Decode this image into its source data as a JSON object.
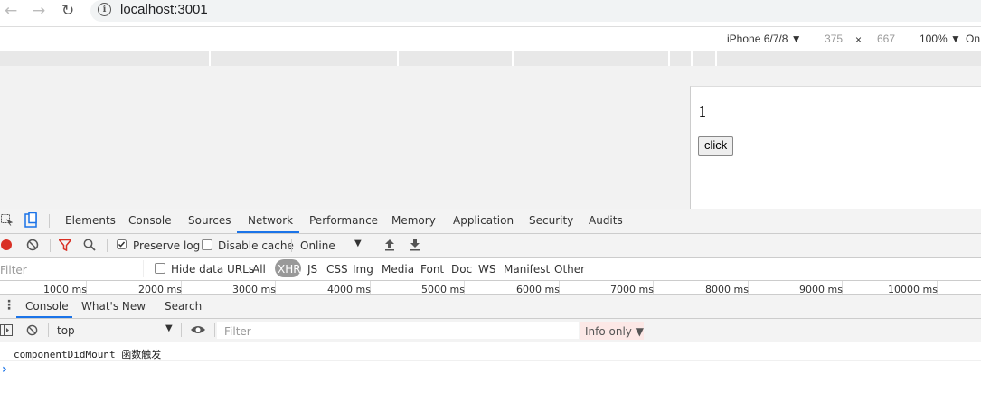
{
  "browser": {
    "url": "localhost:3001",
    "back_icon": "arrow-left-icon",
    "forward_icon": "arrow-right-icon",
    "reload_icon": "reload-icon",
    "info_icon": "info-icon"
  },
  "device_toolbar": {
    "device": "iPhone 6/7/8 ▼",
    "width": "375",
    "times": "×",
    "height": "667",
    "zoom": "100% ▼",
    "throttle": "On"
  },
  "page": {
    "counter": "1",
    "button_label": "click"
  },
  "devtools": {
    "tabs": [
      "Elements",
      "Console",
      "Sources",
      "Network",
      "Performance",
      "Memory",
      "Application",
      "Security",
      "Audits"
    ],
    "active_tab": "Network",
    "network_toolbar": {
      "preserve_log": "Preserve log",
      "disable_cache": "Disable cache",
      "throttling": "Online"
    },
    "filter": {
      "placeholder": "Filter",
      "hide_data_urls": "Hide data URLs",
      "types": [
        "All",
        "XHR",
        "JS",
        "CSS",
        "Img",
        "Media",
        "Font",
        "Doc",
        "WS",
        "Manifest",
        "Other"
      ],
      "active_type": "XHR"
    },
    "timeline_ticks": [
      "1000 ms",
      "2000 ms",
      "3000 ms",
      "4000 ms",
      "5000 ms",
      "6000 ms",
      "7000 ms",
      "8000 ms",
      "9000 ms",
      "10000 ms"
    ],
    "drawer_tabs": [
      "Console",
      "What's New",
      "Search"
    ],
    "active_drawer_tab": "Console",
    "console_toolbar": {
      "context": "top",
      "filter_placeholder": "Filter",
      "levels": "Info only ▼"
    },
    "log": "componentDidMount 函数触发",
    "prompt": "›"
  }
}
